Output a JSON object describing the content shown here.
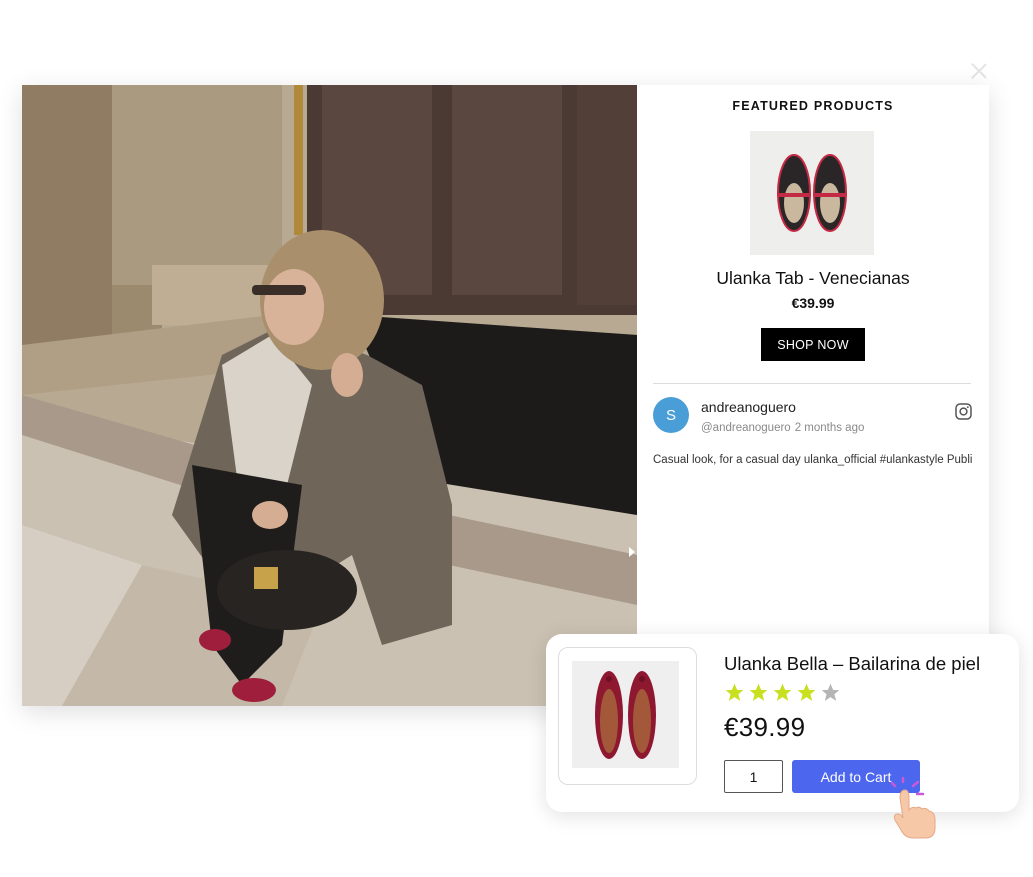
{
  "modal": {
    "featured": {
      "section_title": "FEATURED PRODUCTS",
      "product_name": "Ulanka Tab - Venecianas",
      "price": "€39.99",
      "button_label": "SHOP NOW"
    },
    "post": {
      "avatar_letter": "S",
      "username": "andreanoguero",
      "handle": "@andreanoguero",
      "time_ago": "2 months ago",
      "caption": "Casual look, for a casual day  ulanka_official #ulankastyle Publi",
      "source_icon": "instagram-icon"
    }
  },
  "product_card": {
    "name": "Ulanka Bella – Bailarina de piel",
    "rating": 4,
    "rating_max": 5,
    "price": "€39.99",
    "quantity": "1",
    "button_label": "Add to Cart"
  },
  "colors": {
    "accent_button": "#4c66ee",
    "star_filled": "#c8e020",
    "star_empty": "#b5b5b5",
    "avatar": "#4a9ed8",
    "shop_button": "#000000"
  }
}
